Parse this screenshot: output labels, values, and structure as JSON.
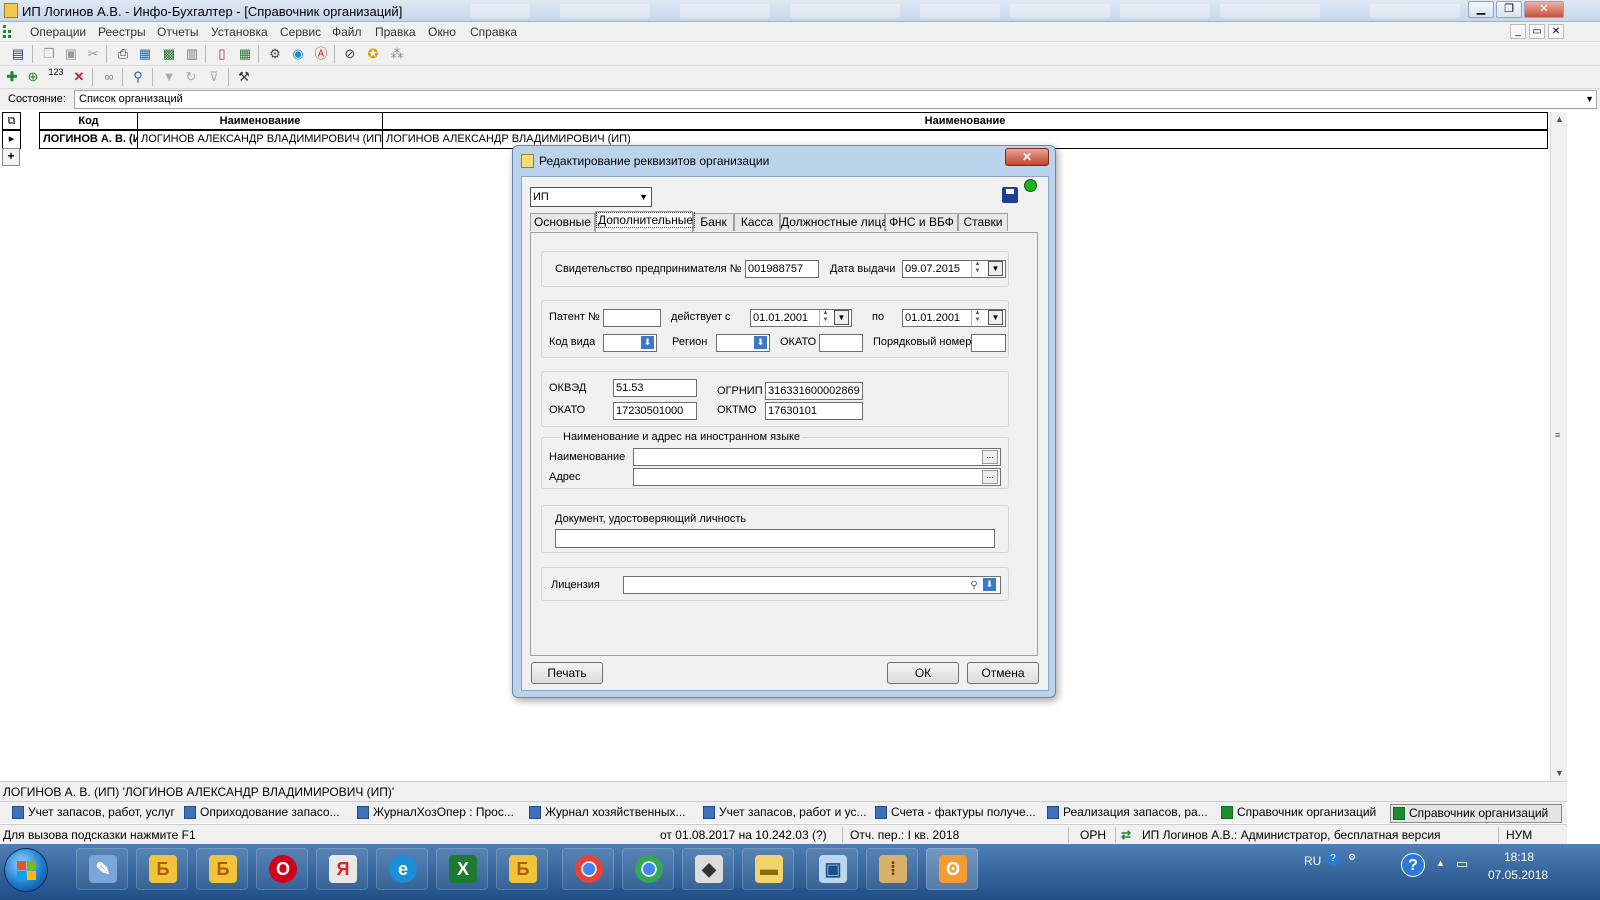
{
  "window": {
    "title": "ИП Логинов А.В. - Инфо-Бухгалтер - [Справочник организаций]",
    "min": "▁",
    "max": "❐",
    "close": "✕"
  },
  "menu": {
    "items": [
      "Операции",
      "Реестры",
      "Отчеты",
      "Установка",
      "Сервис",
      "Файл",
      "Правка",
      "Окно",
      "Справка"
    ],
    "mdi_min": "_",
    "mdi_restore": "▭",
    "mdi_close": "✕"
  },
  "state": {
    "label": "Состояние:",
    "value": "Список организаций"
  },
  "grid": {
    "headers": [
      "Код",
      "Наименование",
      "Наименование"
    ],
    "row": [
      "ЛОГИНОВ А. В. (ИП)",
      "ЛОГИНОВ АЛЕКСАНДР ВЛАДИМИРОВИЧ (ИП)",
      "ЛОГИНОВ АЛЕКСАНДР ВЛАДИМИРОВИЧ (ИП)"
    ],
    "row_marker": "▸",
    "add": "+"
  },
  "dialog": {
    "title": "Редактирование реквизитов организации",
    "close": "✕",
    "type_value": "ИП",
    "tabs": [
      "Основные",
      "Дополнительные",
      "Банк",
      "Касса",
      "Должностные лица",
      "ФНС и ВБФ",
      "Ставки"
    ],
    "active_tab": "Дополнительные",
    "status_color": "#1db31d",
    "cert": {
      "label": "Свидетельство предпринимателя №",
      "number": "001988757",
      "date_label": "Дата выдачи",
      "date": "09.07.2015"
    },
    "patent": {
      "label": "Патент №",
      "number": "",
      "valid_from_label": "действует с",
      "valid_from": "01.01.2001",
      "to_label": "по",
      "valid_to": "01.01.2001",
      "kind_label": "Код вида",
      "region_label": "Регион",
      "okato_label": "ОКАТО",
      "okato": "",
      "seq_label": "Порядковый номер",
      "seq": ""
    },
    "codes": {
      "okved_label": "ОКВЭД",
      "okved": "51.53",
      "ogrnip_label": "ОГРНИП",
      "ogrnip": "316331600002869",
      "okato_label": "ОКАТО",
      "okato": "17230501000",
      "oktmo_label": "ОКТМО",
      "oktmo": "17630101"
    },
    "foreign": {
      "legend": "Наименование и адрес на иностранном языке",
      "name_label": "Наименование",
      "name": "",
      "address_label": "Адрес",
      "address": ""
    },
    "identity": {
      "legend": "Документ, удостоверяющий личность",
      "value": ""
    },
    "license": {
      "label": "Лицензия",
      "value": ""
    },
    "buttons": {
      "print": "Печать",
      "ok": "ОК",
      "cancel": "Отмена"
    },
    "dots": "..."
  },
  "status": {
    "line": "ЛОГИНОВ А. В. (ИП) 'ЛОГИНОВ АЛЕКСАНДР ВЛАДИМИРОВИЧ (ИП)'",
    "hint": "Для вызова подсказки нажмите F1",
    "period": "от 01.08.2017 на 10.242.03 (?)",
    "report_period": "Отч. пер.: I кв. 2018",
    "mode": "ОРН",
    "user": "ИП Логинов А.В.: Администратор, бесплатная версия",
    "num": "НУМ"
  },
  "window_tabs": [
    "Учет запасов, работ, услуг",
    "Оприходование запасо...",
    "ЖурналХозОпер : Прос...",
    "Журнал хозяйственных...",
    "Учет запасов, работ и ус...",
    "Счета - фактуры получе...",
    "Реализация запасов, ра...",
    "Справочник организаций",
    "Справочник организаций"
  ],
  "taskbar": {
    "lang": "RU",
    "time": "18:18",
    "date": "07.05.2018",
    "help": "?"
  }
}
